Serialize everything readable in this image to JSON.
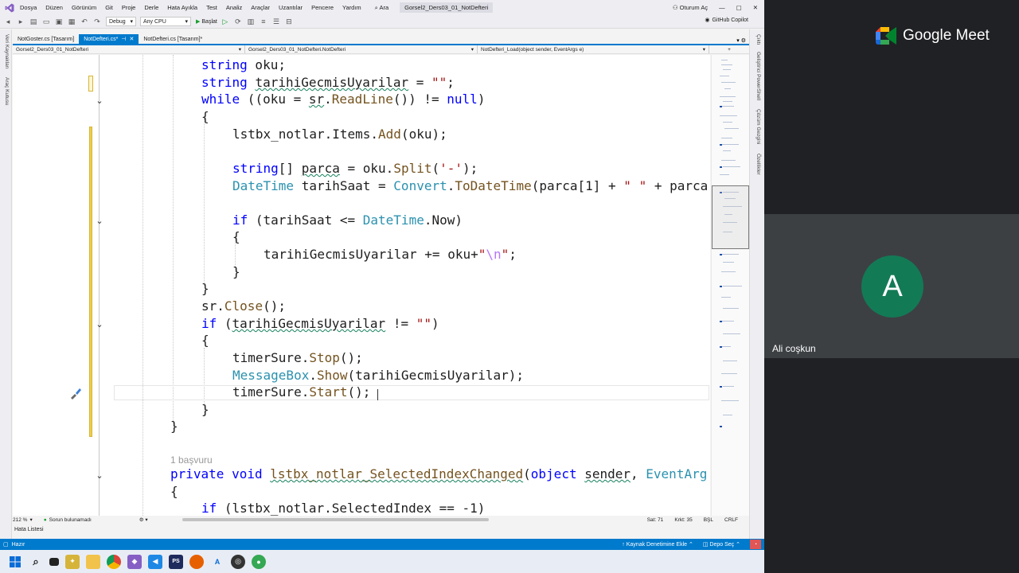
{
  "menubar": {
    "items": [
      "Dosya",
      "Düzen",
      "Görünüm",
      "Git",
      "Proje",
      "Derle",
      "Hata Ayıkla",
      "Test",
      "Analiz",
      "Araçlar",
      "Uzantılar",
      "Pencere",
      "Yardım"
    ],
    "search": "Ara",
    "solution_title": "Gorsel2_Ders03_01_NotDefteri",
    "signin": "Oturum Aç"
  },
  "toolbar": {
    "config": "Debug",
    "platform": "Any CPU",
    "start": "Başlat",
    "copilot": "GitHub Copilot"
  },
  "left_panels": [
    "Veri Kaynakları",
    "Araç Kutusu"
  ],
  "right_panels": [
    "Çıktı",
    "Geliştirici PowerShell",
    "Çözüm Gezgini",
    "Özellikler"
  ],
  "tabs": [
    {
      "label": "NotGoster.cs [Tasarım]",
      "active": false
    },
    {
      "label": "NotDefteri.cs*",
      "active": true
    },
    {
      "label": "NotDefteri.cs [Tasarım]*",
      "active": false
    }
  ],
  "navbar": {
    "project": "Gorsel2_Ders03_01_NotDefteri",
    "class": "Gorsel2_Ders03_01_NotDefteri.NotDefteri",
    "member": "NotDefteri_Load(object sender, EventArgs e)"
  },
  "code": {
    "l1_kw": "string",
    "l1_rest": " oku;",
    "l2_kw": "string",
    "l2_var": "tarihiGecmisUyarilar",
    "l2_op": " = ",
    "l2_str": "\"\"",
    "l2_end": ";",
    "l3_kw": "while",
    "l3_a": " ((oku = ",
    "l3_sr": "sr",
    "l3_dot": ".",
    "l3_m": "ReadLine",
    "l3_b": "()) != ",
    "l3_null": "null",
    "l3_c": ")",
    "l4": "{",
    "l5_a": "lstbx_notlar.Items.",
    "l5_m": "Add",
    "l5_b": "(oku);",
    "l7_kw": "string",
    "l7_a": "[] ",
    "l7_var": "parca",
    "l7_b": " = oku.",
    "l7_m": "Split",
    "l7_c": "(",
    "l7_str": "'-'",
    "l7_d": ");",
    "l8_t": "DateTime",
    "l8_a": " tarihSaat = ",
    "l8_t2": "Convert",
    "l8_b": ".",
    "l8_m": "ToDateTime",
    "l8_c": "(parca[1] + ",
    "l8_str": "\" \"",
    "l8_d": " + parca",
    "l10_kw": "if",
    "l10_a": " (tarihSaat <= ",
    "l10_t": "DateTime",
    "l10_b": ".Now)",
    "l11": "{",
    "l12_a": "tarihiGecmisUyarilar += oku+",
    "l12_q1": "\"",
    "l12_esc": "\\n",
    "l12_q2": "\"",
    "l12_b": ";",
    "l13": "}",
    "l14": "}",
    "l15_a": "sr.",
    "l15_m": "Close",
    "l15_b": "();",
    "l16_kw": "if",
    "l16_a": " (",
    "l16_var": "tarihiGecmisUyarilar",
    "l16_b": " != ",
    "l16_str": "\"\"",
    "l16_c": ")",
    "l17": "{",
    "l18_a": "timerSure.",
    "l18_m": "Stop",
    "l18_b": "();",
    "l19_t": "MessageBox",
    "l19_a": ".",
    "l19_m": "Show",
    "l19_b": "(tarihiGecmisUyarilar);",
    "l20_a": "timerSure.",
    "l20_m": "Start",
    "l20_b": "();",
    "l21": "}",
    "l22": "}",
    "ref": "1 başvuru",
    "l24_kw1": "private",
    "l24_kw2": " void",
    "l24_sp": " ",
    "l24_m": "lstbx_notlar_SelectedIndexChanged",
    "l24_a": "(",
    "l24_kw3": "object",
    "l24_b": " ",
    "l24_var": "sender",
    "l24_c": ", ",
    "l24_t": "EventArg",
    "l25": "{",
    "l26_kw": "if",
    "l26_a": " (lstbx_notlar.SelectedIndex == -1)"
  },
  "statusbar": {
    "zoom": "212 %",
    "issues": "Sorun bulunamadı",
    "line": "Sat: 71",
    "col": "Krkt: 35",
    "mode": "BŞL",
    "eol": "CRLF"
  },
  "bottom_panel": "Hata Listesi",
  "bluebar": {
    "ready": "Hazır",
    "source_control": "Kaynak Denetimine Ekle",
    "repo": "Depo Seç"
  },
  "meet": {
    "brand": "Google Meet",
    "initial": "A",
    "participant": "Ali coşkun"
  },
  "colors": {
    "vs_accent": "#007acc",
    "meet_bg": "#202124",
    "tile_bg": "#3c4043",
    "avatar_bg": "#137a56"
  }
}
